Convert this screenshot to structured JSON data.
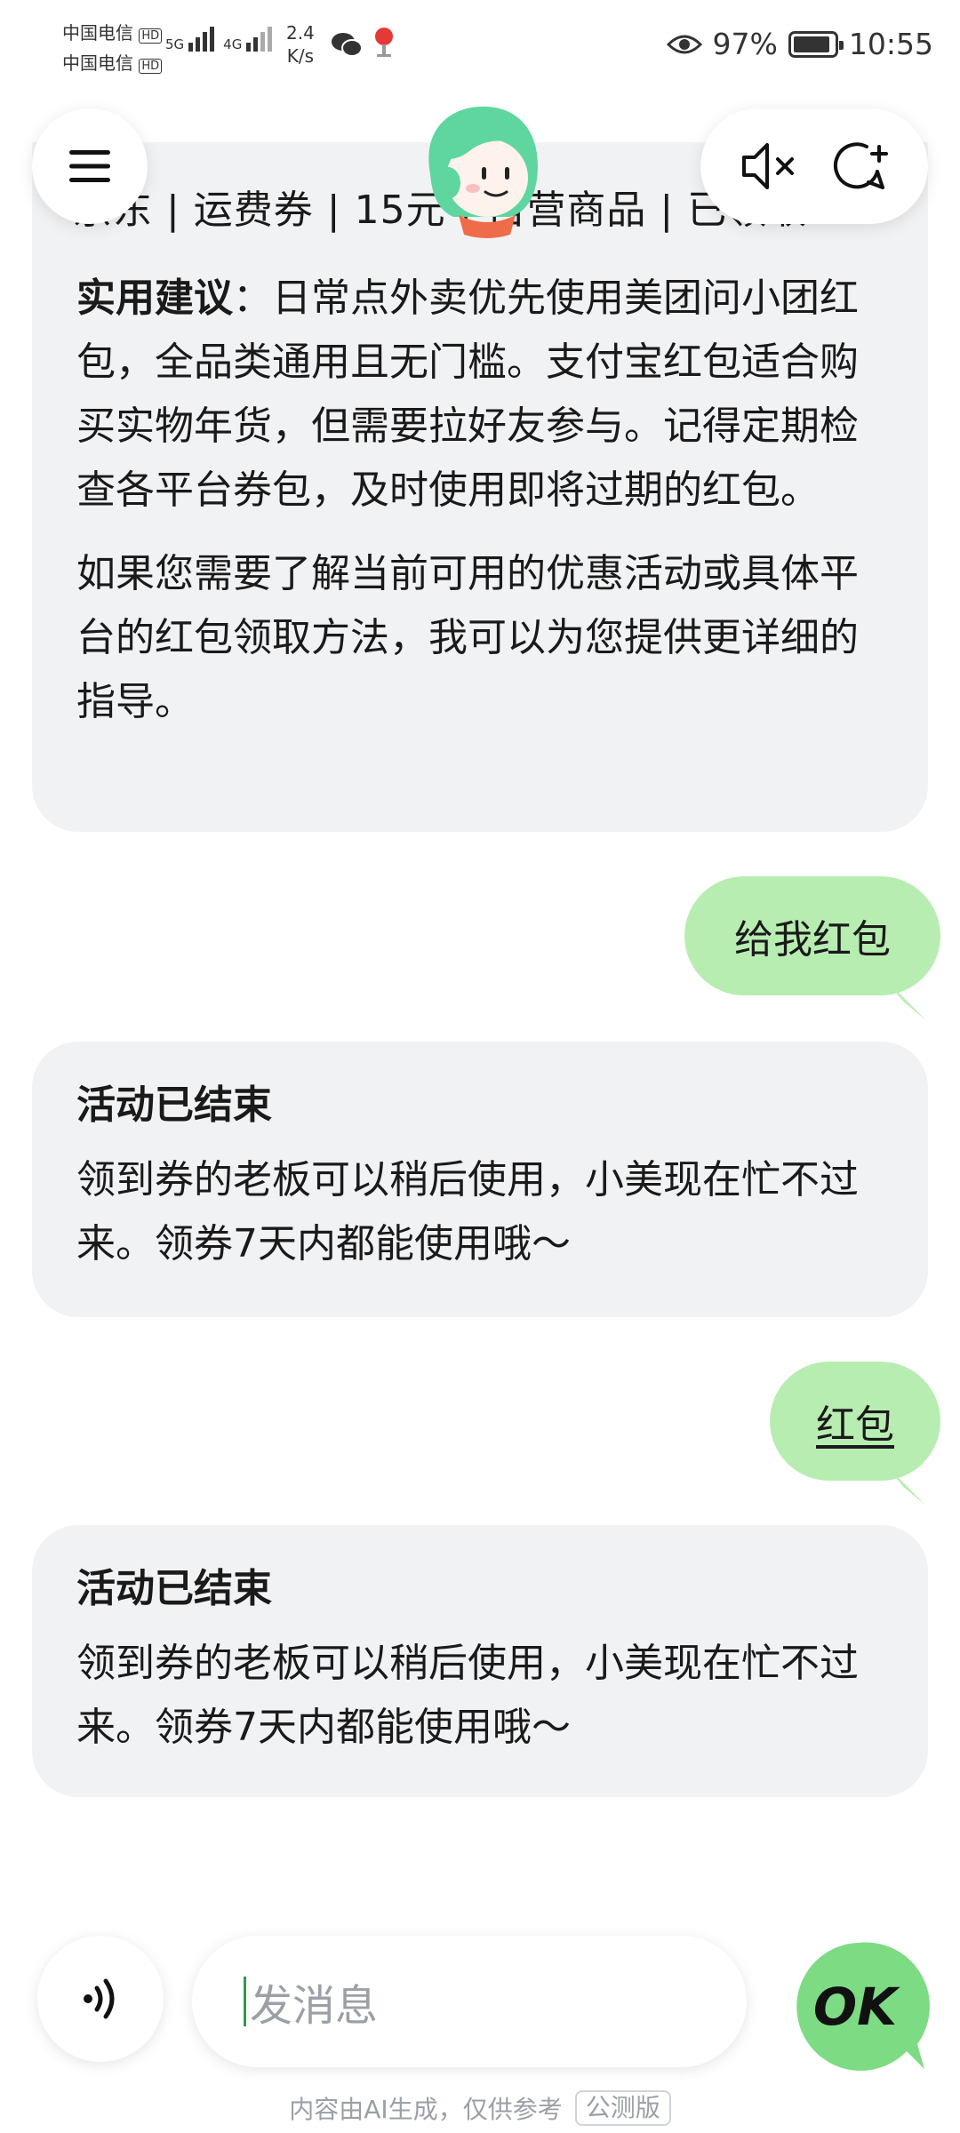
{
  "status_bar": {
    "carrier_1": "中国电信",
    "carrier_2": "中国电信",
    "hd_badge": "HD",
    "net_type_1": "5G",
    "net_type_2": "4G",
    "net_speed": "2.4",
    "net_speed_unit": "K/s",
    "battery": "97%",
    "time": "10:55"
  },
  "header": {
    "cut_text": "京东 | 运费券 | 15元 | 自营商品 | 已领取"
  },
  "messages": {
    "bot_1": {
      "advice_label": "实用建议",
      "advice_text": "：日常点外卖优先使用美团问小团红包，全品类通用且无门槛。支付宝红包适合购买实物年货，但需要拉好友参与。记得定期检查各平台券包，及时使用即将过期的红包。",
      "para_2": "如果您需要了解当前可用的优惠活动或具体平台的红包领取方法，我可以为您提供更详细的指导。"
    },
    "user_1": "给我红包",
    "bot_2": {
      "title": "活动已结束",
      "text": "领到券的老板可以稍后使用，小美现在忙不过来。领券7天内都能使用哦～"
    },
    "user_2": "红包",
    "bot_3": {
      "title": "活动已结束",
      "text": "领到券的老板可以稍后使用，小美现在忙不过来。领券7天内都能使用哦～"
    }
  },
  "input": {
    "placeholder": "发消息",
    "send_label": "OK"
  },
  "footer": {
    "disclaimer": "内容由AI生成，仅供参考",
    "badge": "公测版"
  },
  "icons": {
    "menu": "hamburger-icon",
    "mute": "speaker-muted-icon",
    "new_chat": "new-chat-icon",
    "voice": "voice-wave-icon"
  },
  "colors": {
    "user_bubble": "#b8edb2",
    "bot_bubble": "#f1f2f4",
    "ok_button": "#7ddb84"
  }
}
